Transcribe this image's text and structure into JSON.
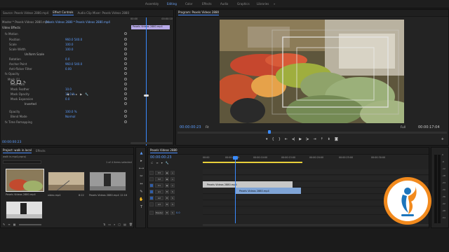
{
  "workspaces": [
    "Assembly",
    "Editing",
    "Color",
    "Effects",
    "Audio",
    "Graphics",
    "Libraries"
  ],
  "active_workspace_index": 1,
  "effect_controls": {
    "tabs": [
      "Source: Pexels Videos 2880.mp4",
      "Effect Controls",
      "Audio Clip Mixer: Pexels Videos 2880"
    ],
    "active_tab_index": 1,
    "master_label": "Master * Pexels Videos 2880.mp4",
    "clip_label": "Pexels Videos 2880 * Pexels Videos 2880.mp4",
    "clip_tag": "Pexels Videos 2880.mp4",
    "ruler_start": "00:00",
    "ruler_end": "00:00:10",
    "section_video": "Video Effects",
    "rows": [
      {
        "label": "fx  Motion",
        "value": ""
      },
      {
        "label": "Position",
        "value": "960.0   540.0"
      },
      {
        "label": "Scale",
        "value": "100.0"
      },
      {
        "label": "Scale Width",
        "value": "100.0"
      },
      {
        "label": "",
        "value": "Uniform Scale"
      },
      {
        "label": "Rotation",
        "value": "0.0"
      },
      {
        "label": "Anchor Point",
        "value": "960.0   540.0"
      },
      {
        "label": "Anti-flicker Filter",
        "value": "0.00"
      },
      {
        "label": "fx  Opacity",
        "value": ""
      },
      {
        "label": "Mask (1)",
        "value": ""
      },
      {
        "label": "Mask Path",
        "value": ""
      },
      {
        "label": "Mask Feather",
        "value": "10.0"
      },
      {
        "label": "Mask Opacity",
        "value": "15.0 %"
      },
      {
        "label": "Mask Expansion",
        "value": "0.0"
      },
      {
        "label": "",
        "value": "Inverted"
      },
      {
        "label": "Opacity",
        "value": "100.0 %"
      },
      {
        "label": "Blend Mode",
        "value": "Normal"
      },
      {
        "label": "fx  Time Remapping",
        "value": ""
      }
    ],
    "timecode": "00:00:00:23"
  },
  "program": {
    "tab": "Program: Pexels Videos 2880",
    "timecode_left": "00:00:00:23",
    "fit": "Fit",
    "quality": "Full",
    "timecode_right": "00:00:17:04",
    "transport": [
      "marker",
      "in",
      "out",
      "step-back",
      "play",
      "step-forward",
      "out-2",
      "lift",
      "extract",
      "camera"
    ]
  },
  "project": {
    "tabs": [
      "Project: walk in.local",
      "Effects"
    ],
    "active_tab_index": 0,
    "search_value": "walk in.mp4.prproj",
    "items_selected": "1 of 4 items selected",
    "items": [
      {
        "name": "Pexels Videos 2880.mp4",
        "duration": "17:04"
      },
      {
        "name": "video.mp4",
        "duration": "8:22"
      },
      {
        "name": "Pexels Videos 2880.mp4",
        "duration": "12:16"
      },
      {
        "name": "street.mp4",
        "duration": ""
      }
    ]
  },
  "timeline": {
    "tab": "Pexels Videos 2880",
    "timecode": "00:00:00:23",
    "ruler": [
      "00:00",
      "00:00:05:00",
      "00:00:10:00",
      "00:00:15:00",
      "00:00:20:00",
      "00:00:25:00",
      "00:00:30:00"
    ],
    "tracks": [
      "V3",
      "V2",
      "V1",
      "A1",
      "A2",
      "A3",
      "Master"
    ],
    "master_value": "0.0",
    "clips": [
      {
        "track": "V2",
        "label": "Pexels Videos 2880.mp4",
        "color": "#c7c7c7"
      },
      {
        "track": "V1",
        "label": "Pexels Videos 2880.mp4",
        "color": "#7fa4d6"
      }
    ]
  },
  "meters": [
    "0",
    "-6",
    "-12",
    "-18",
    "-24",
    "-30",
    "-36",
    "-42",
    "-48",
    "-54"
  ],
  "colors": {
    "accent": "#3a8bff",
    "panel": "#232323",
    "clip_video": "#7fa4d6",
    "clip_grey": "#c7c7c7",
    "logo_orange": "#f28a1d",
    "logo_blue": "#1c75bc"
  }
}
